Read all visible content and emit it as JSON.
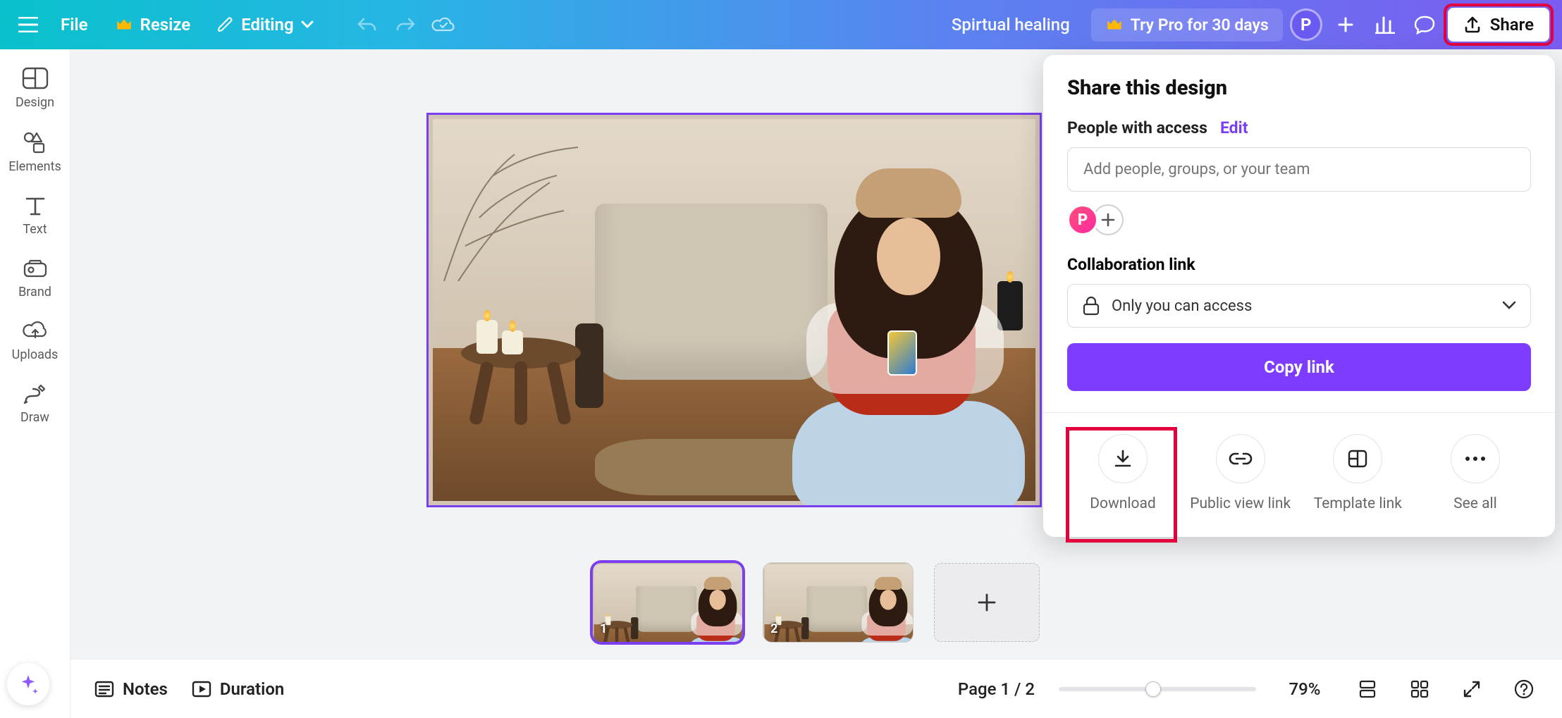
{
  "topbar": {
    "file_label": "File",
    "resize_label": "Resize",
    "editing_label": "Editing",
    "doc_title": "Spirtual healing",
    "try_pro_label": "Try Pro for 30 days",
    "avatar_letter": "P",
    "share_label": "Share"
  },
  "sidebar": {
    "items": [
      {
        "id": "design",
        "label": "Design"
      },
      {
        "id": "elements",
        "label": "Elements"
      },
      {
        "id": "text",
        "label": "Text"
      },
      {
        "id": "brand",
        "label": "Brand"
      },
      {
        "id": "uploads",
        "label": "Uploads"
      },
      {
        "id": "draw",
        "label": "Draw"
      }
    ]
  },
  "thumbnails": {
    "page1_num": "1",
    "page2_num": "2"
  },
  "share_panel": {
    "title": "Share this design",
    "people_label": "People with access",
    "edit_label": "Edit",
    "people_placeholder": "Add people, groups, or your team",
    "owner_avatar_letter": "P",
    "collab_label": "Collaboration link",
    "access_value": "Only you can access",
    "copy_label": "Copy link",
    "actions": {
      "download": "Download",
      "public_view": "Public view link",
      "template_link": "Template link",
      "see_all": "See all"
    }
  },
  "bottombar": {
    "notes_label": "Notes",
    "duration_label": "Duration",
    "page_indicator": "Page 1 / 2",
    "zoom_pct": "79%"
  },
  "colors": {
    "accent_purple": "#7a3ff0",
    "cta_purple": "#7d3cff",
    "highlight_red": "#e3003f"
  }
}
